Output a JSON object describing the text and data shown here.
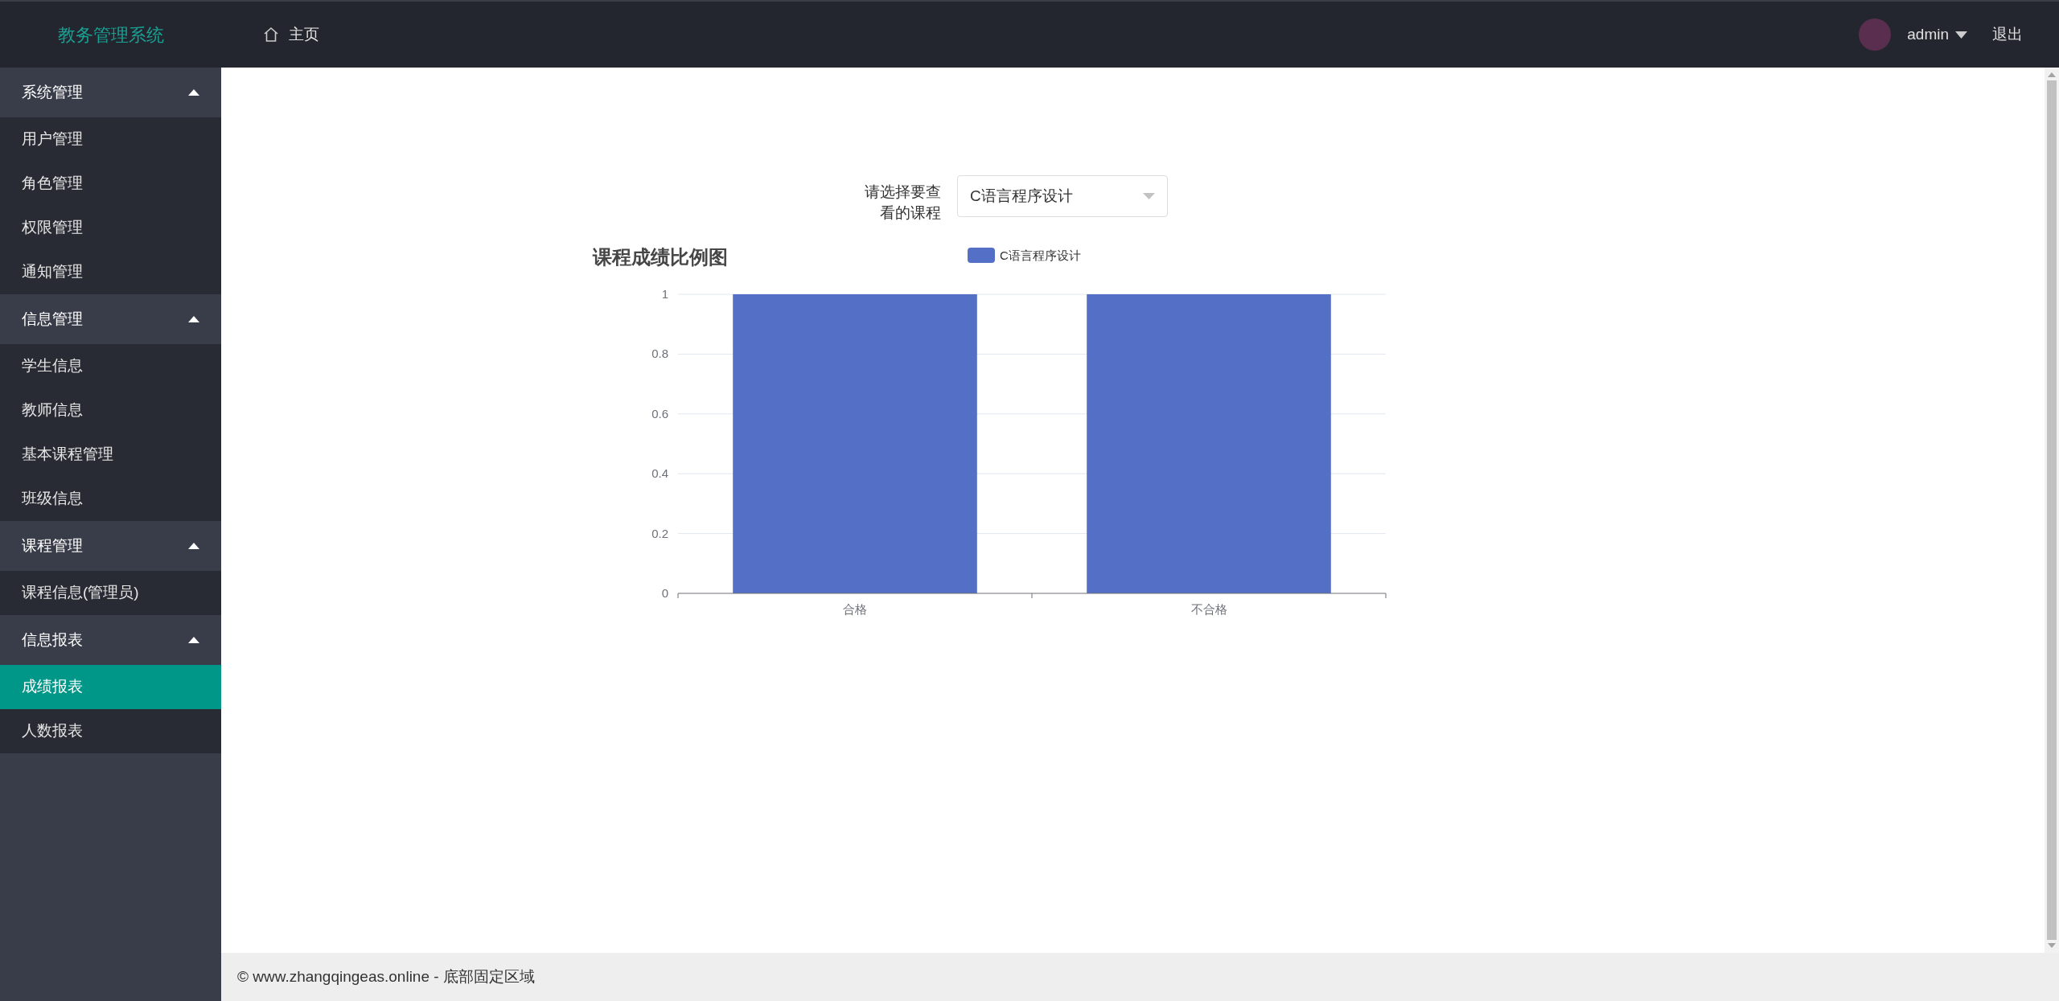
{
  "header": {
    "title": "教务管理系统",
    "home": "主页",
    "user": "admin",
    "logout": "退出"
  },
  "sidebar": {
    "groups": [
      {
        "label": "系统管理",
        "expanded": true,
        "items": [
          {
            "label": "用户管理",
            "selected": false
          },
          {
            "label": "角色管理",
            "selected": false
          },
          {
            "label": "权限管理",
            "selected": false
          },
          {
            "label": "通知管理",
            "selected": false
          }
        ]
      },
      {
        "label": "信息管理",
        "expanded": true,
        "items": [
          {
            "label": "学生信息",
            "selected": false
          },
          {
            "label": "教师信息",
            "selected": false
          },
          {
            "label": "基本课程管理",
            "selected": false
          },
          {
            "label": "班级信息",
            "selected": false
          }
        ]
      },
      {
        "label": "课程管理",
        "expanded": true,
        "items": [
          {
            "label": "课程信息(管理员)",
            "selected": false
          }
        ]
      },
      {
        "label": "信息报表",
        "expanded": true,
        "items": [
          {
            "label": "成绩报表",
            "selected": true
          },
          {
            "label": "人数报表",
            "selected": false
          }
        ]
      }
    ]
  },
  "course_select": {
    "label": "请选择要查看的课程",
    "value": "C语言程序设计"
  },
  "chart": {
    "chart_data": {
      "type": "bar",
      "title": "课程成绩比例图",
      "categories": [
        "合格",
        "不合格"
      ],
      "series": [
        {
          "name": "C语言程序设计",
          "color": "#5470c6",
          "values": [
            1,
            1
          ]
        }
      ],
      "ylim": [
        0,
        1
      ],
      "grid": true,
      "yticks": [
        0,
        0.2,
        0.4,
        0.6,
        0.8,
        1
      ]
    }
  },
  "footer": {
    "text": "© www.zhangqingeas.online - 底部固定区域"
  }
}
